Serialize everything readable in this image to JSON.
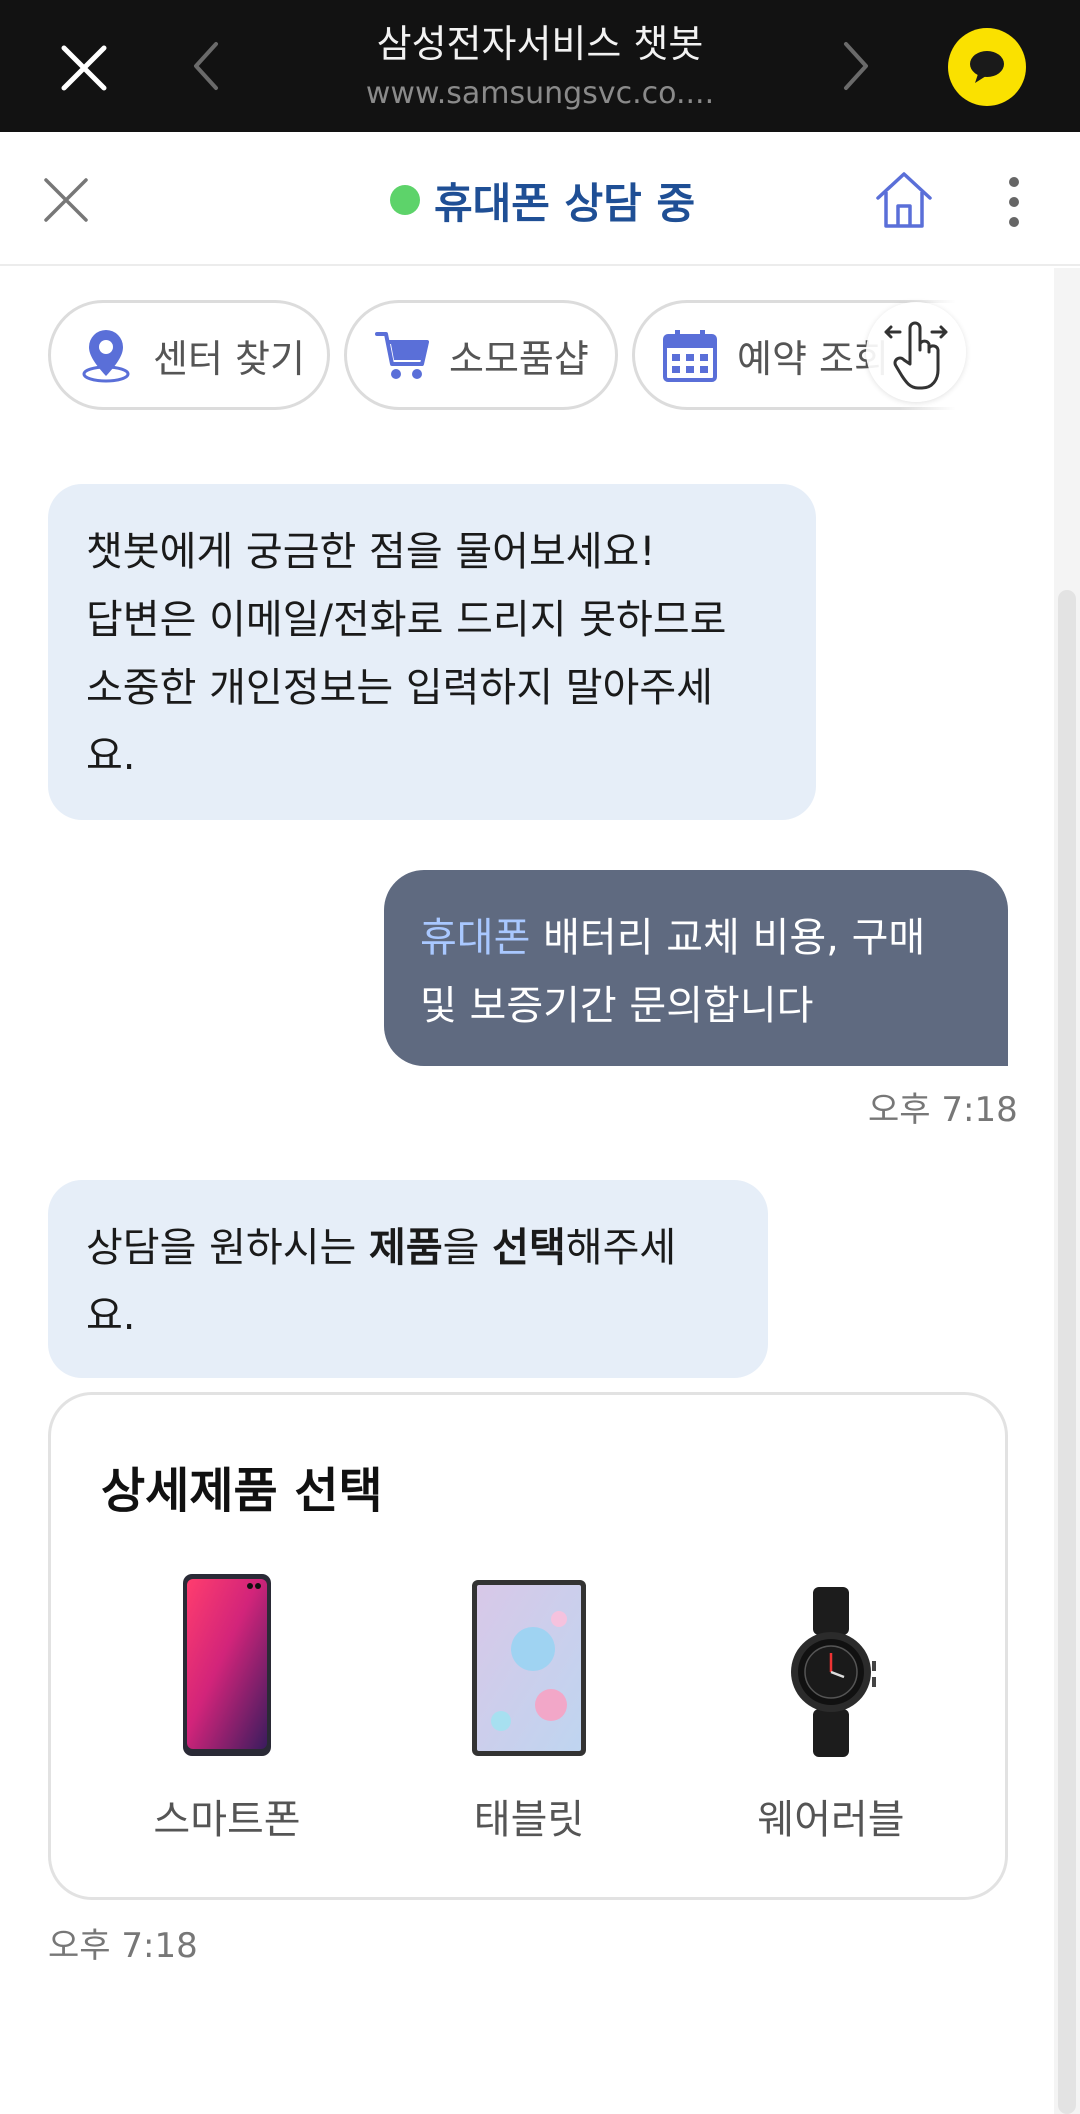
{
  "browser": {
    "title": "삼성전자서비스 챗봇",
    "url": "www.samsungsvc.co...."
  },
  "header": {
    "status": "휴대폰 상담 중",
    "status_color": "#5dd36a"
  },
  "quick_menu": [
    {
      "label": "센터 찾기",
      "icon": "location-pin-icon"
    },
    {
      "label": "소모품샵",
      "icon": "shopping-cart-icon"
    },
    {
      "label": "예약 조회",
      "icon": "calendar-icon"
    }
  ],
  "messages": {
    "bot_intro": {
      "line1": "챗봇에게 궁금한 점을 물어보세요!",
      "line2": "답변은 이메일/전화로 드리지 못하므로",
      "line3": "소중한 개인정보는 입력하지 말아주세",
      "line4": "요."
    },
    "user": {
      "highlight": "휴대폰",
      "rest1": " 배터리 교체 비용, 구매",
      "line2": "및 보증기간 문의합니다"
    },
    "user_time": "오후 7:18",
    "bot_select": {
      "part1": "상담을 원하시는 ",
      "bold1": "제품",
      "part2": "을 ",
      "bold2": "선택",
      "part3": "해주세",
      "line2": "요."
    },
    "card_time": "오후 7:18"
  },
  "product_card": {
    "title": "상세제품 선택",
    "items": [
      {
        "label": "스마트폰",
        "icon": "smartphone-icon"
      },
      {
        "label": "태블릿",
        "icon": "tablet-icon"
      },
      {
        "label": "웨어러블",
        "icon": "smartwatch-icon"
      }
    ]
  },
  "colors": {
    "accent": "#1f4f95",
    "bot_bubble": "#e6eef8",
    "user_bubble": "#5f6a80",
    "kakao": "#fae100"
  }
}
